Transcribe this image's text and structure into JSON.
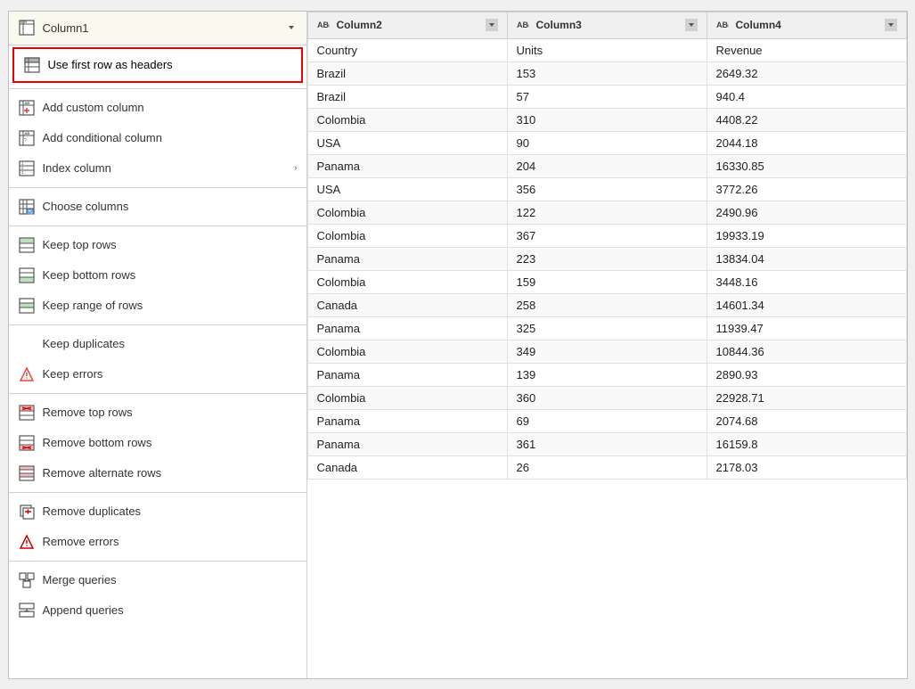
{
  "header": {
    "col1_label": "Column1",
    "col2_label": "Column2",
    "col3_label": "Column3",
    "col4_label": "Column4"
  },
  "menu": {
    "use_first_row": "Use first row as headers",
    "add_custom_col": "Add custom column",
    "add_conditional_col": "Add conditional column",
    "index_column": "Index column",
    "choose_columns": "Choose columns",
    "keep_top_rows": "Keep top rows",
    "keep_bottom_rows": "Keep bottom rows",
    "keep_range_of_rows": "Keep range of rows",
    "keep_duplicates": "Keep duplicates",
    "keep_errors": "Keep errors",
    "remove_top_rows": "Remove top rows",
    "remove_bottom_rows": "Remove bottom rows",
    "remove_alternate_rows": "Remove alternate rows",
    "remove_duplicates": "Remove duplicates",
    "remove_errors": "Remove errors",
    "merge_queries": "Merge queries",
    "append_queries": "Append queries"
  },
  "table": {
    "columns": [
      "Column2",
      "Column3",
      "Column4"
    ],
    "rows": [
      {
        "col2": "Country",
        "col3": "Units",
        "col4": "Revenue"
      },
      {
        "col2": "Brazil",
        "col3": "153",
        "col4": "2649.32"
      },
      {
        "col2": "Brazil",
        "col3": "57",
        "col4": "940.4"
      },
      {
        "col2": "Colombia",
        "col3": "310",
        "col4": "4408.22"
      },
      {
        "col2": "USA",
        "col3": "90",
        "col4": "2044.18"
      },
      {
        "col2": "Panama",
        "col3": "204",
        "col4": "16330.85"
      },
      {
        "col2": "USA",
        "col3": "356",
        "col4": "3772.26"
      },
      {
        "col2": "Colombia",
        "col3": "122",
        "col4": "2490.96"
      },
      {
        "col2": "Colombia",
        "col3": "367",
        "col4": "19933.19"
      },
      {
        "col2": "Panama",
        "col3": "223",
        "col4": "13834.04"
      },
      {
        "col2": "Colombia",
        "col3": "159",
        "col4": "3448.16"
      },
      {
        "col2": "Canada",
        "col3": "258",
        "col4": "14601.34"
      },
      {
        "col2": "Panama",
        "col3": "325",
        "col4": "11939.47"
      },
      {
        "col2": "Colombia",
        "col3": "349",
        "col4": "10844.36"
      },
      {
        "col2": "Panama",
        "col3": "139",
        "col4": "2890.93"
      },
      {
        "col2": "Colombia",
        "col3": "360",
        "col4": "22928.71"
      },
      {
        "col2": "Panama",
        "col3": "69",
        "col4": "2074.68"
      },
      {
        "col2": "Panama",
        "col3": "361",
        "col4": "16159.8"
      },
      {
        "col2": "Canada",
        "col3": "26",
        "col4": "2178.03"
      }
    ]
  }
}
